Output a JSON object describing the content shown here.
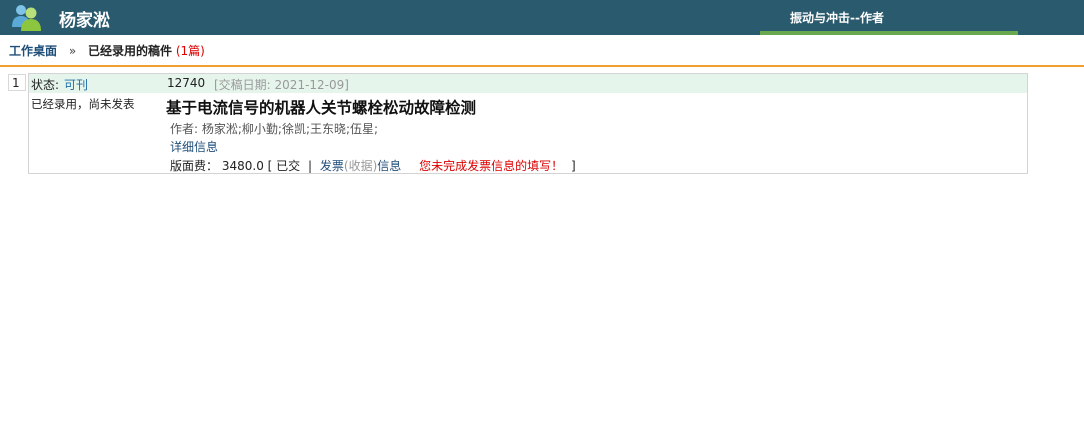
{
  "header": {
    "username": "杨家淞",
    "journal_role": "振动与冲击--作者",
    "colors": {
      "bar": "#2a5a6e",
      "accent_green": "#6aa84f",
      "divider_orange": "#f0a030"
    }
  },
  "breadcrumb": {
    "home": "工作桌面",
    "separator": "»",
    "current": "已经录用的稿件",
    "count": "(1篇)"
  },
  "manuscripts": [
    {
      "index": "1",
      "status_label": "状态:",
      "status_value": "可刊",
      "id": "12740",
      "submit_date": "[交稿日期: 2021-12-09]",
      "left_note": "已经录用，尚未发表",
      "title": "基于电流信号的机器人关节螺栓松动故障检测",
      "authors": "作者: 杨家淞;柳小勤;徐凯;王东晓;伍星;",
      "detail_link": "详细信息",
      "fee_label": "版面费：",
      "fee_value": "3480.0",
      "fee_paid": "[ 已交",
      "fee_sep": "|",
      "invoice_link1": "发票",
      "invoice_receipt": "(收据)",
      "invoice_link2": "信息",
      "invoice_warning": "您未完成发票信息的填写！",
      "fee_close": "]"
    }
  ]
}
